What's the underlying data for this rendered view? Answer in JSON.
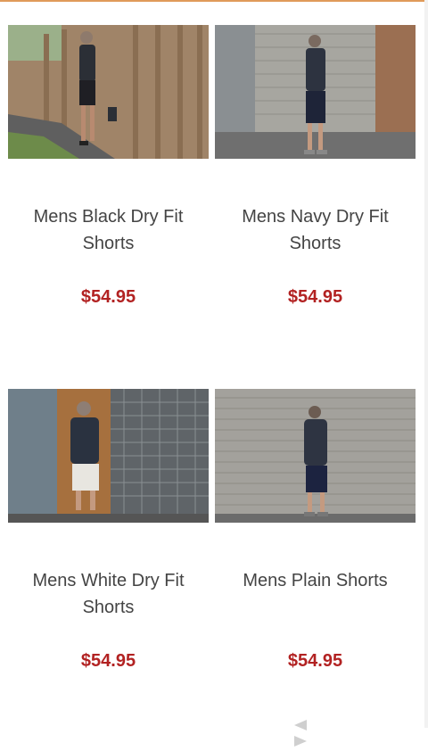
{
  "products": [
    {
      "name": "Mens Black Dry Fit Shorts",
      "price": "$54.95",
      "image": "man-black-shorts-wooden-fence-photo"
    },
    {
      "name": "Mens Navy Dry Fit Shorts",
      "price": "$54.95",
      "image": "man-navy-shorts-roller-door-photo"
    },
    {
      "name": "Mens White Dry Fit Shorts",
      "price": "$54.95",
      "image": "man-white-shorts-metal-gate-photo"
    },
    {
      "name": "Mens Plain Shorts",
      "price": "$54.95",
      "image": "man-plain-shorts-roller-door-photo"
    }
  ],
  "colors": {
    "accent_line": "#e09a5a",
    "price": "#b22222",
    "text": "#444444"
  },
  "pager": {
    "prev_icon": "chevron-left-icon",
    "next_icon": "chevron-right-icon"
  }
}
